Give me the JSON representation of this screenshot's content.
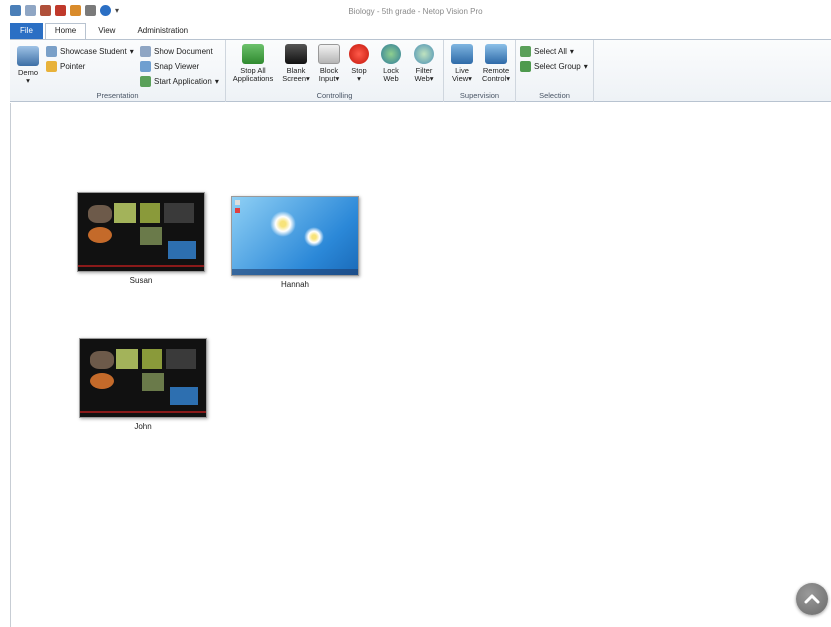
{
  "window": {
    "title": "Biology - 5th grade - Netop Vision Pro"
  },
  "quick_access": [
    "computer-icon",
    "document-icon",
    "users-icon",
    "book-icon",
    "shield-icon",
    "tools-icon",
    "help-icon"
  ],
  "tabs": [
    {
      "label": "File"
    },
    {
      "label": "Home"
    },
    {
      "label": "View"
    },
    {
      "label": "Administration"
    }
  ],
  "ribbon": {
    "presentation": {
      "label": "Presentation",
      "demo": "Demo",
      "showcase": "Showcase Student",
      "pointer": "Pointer",
      "show_document": "Show Document",
      "snap_viewer": "Snap Viewer",
      "start_application": "Start Application"
    },
    "controlling": {
      "label": "Controlling",
      "stop_all_1": "Stop All",
      "stop_all_2": "Applications",
      "blank_1": "Blank",
      "blank_2": "Screen",
      "block_1": "Block",
      "block_2": "Input",
      "stop": "Stop",
      "lock_1": "Lock",
      "lock_2": "Web",
      "filter_1": "Filter",
      "filter_2": "Web"
    },
    "supervision": {
      "label": "Supervision",
      "live_1": "Live",
      "live_2": "View",
      "remote_1": "Remote",
      "remote_2": "Control"
    },
    "selection": {
      "label": "Selection",
      "select_all": "Select All",
      "select_group": "Select Group"
    }
  },
  "students": [
    {
      "name": "Susan"
    },
    {
      "name": "Hannah"
    },
    {
      "name": "John"
    }
  ]
}
